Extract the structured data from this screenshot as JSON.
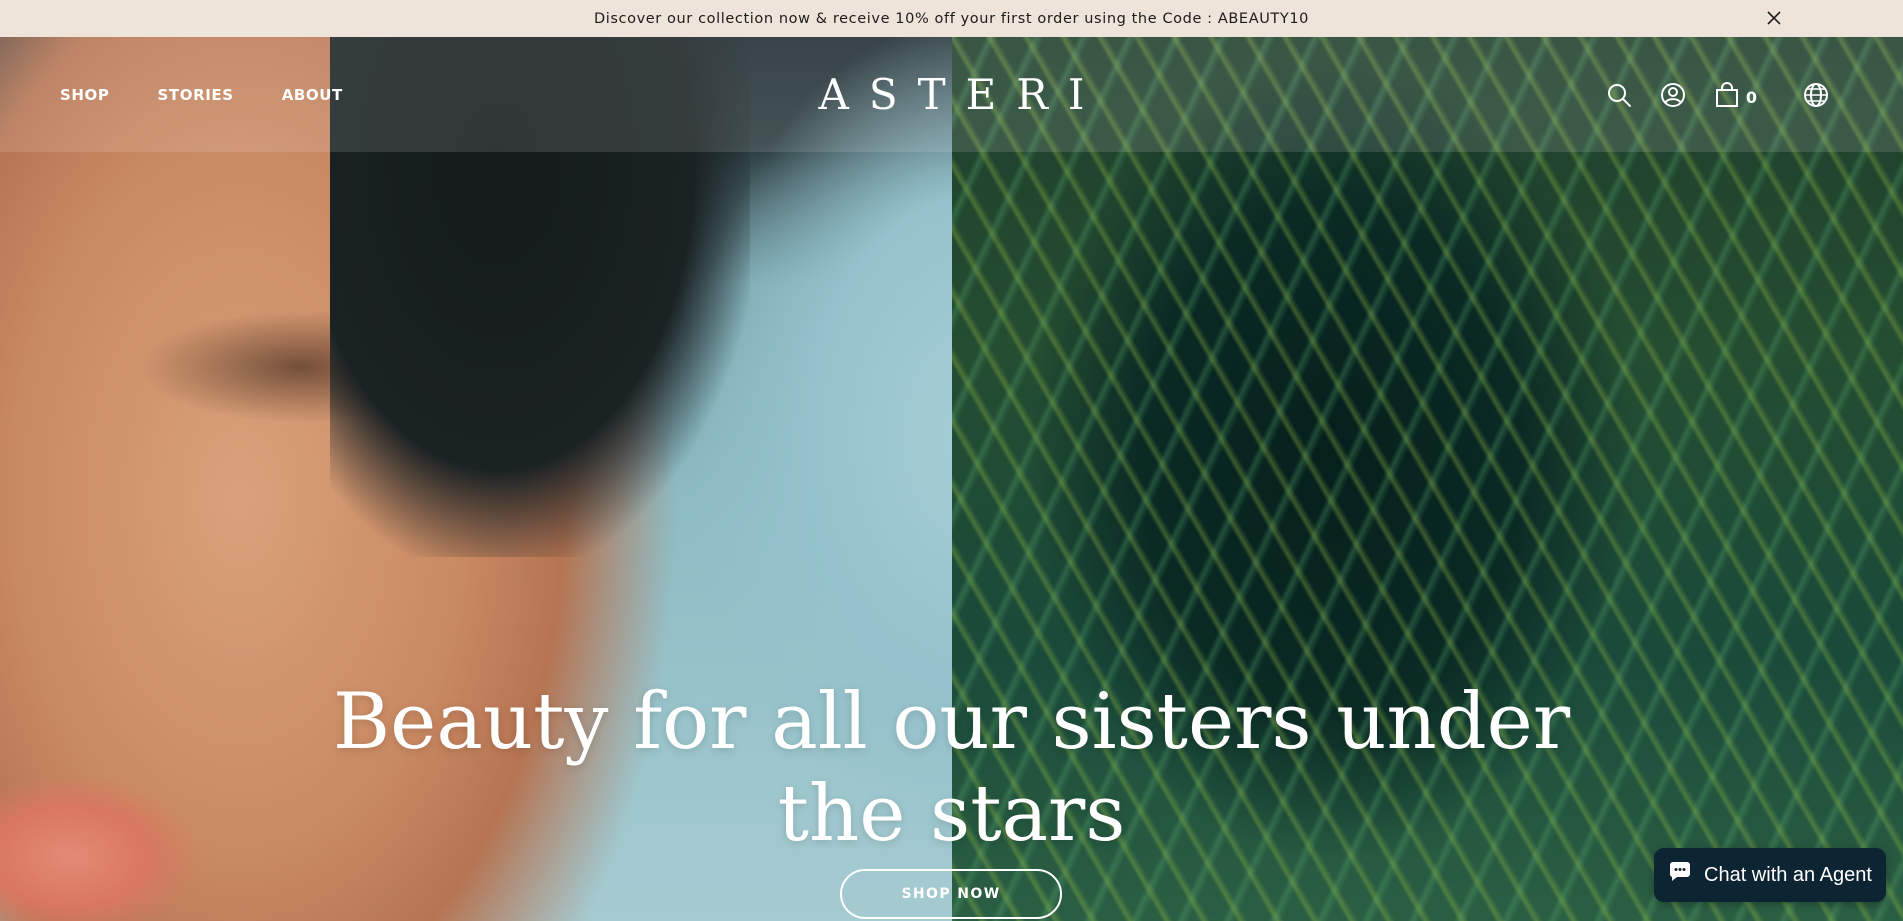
{
  "announcement": {
    "text": "Discover our collection now & receive 10% off your first order using the Code : ABEAUTY10",
    "close_icon": "close-icon"
  },
  "nav": {
    "links": [
      "SHOP",
      "STORIES",
      "ABOUT"
    ],
    "logo": "ASTERI",
    "icons": [
      "search-icon",
      "account-icon",
      "cart-icon",
      "globe-icon"
    ],
    "cart_count": "0"
  },
  "hero": {
    "headline_line1": "Beauty for all our sisters under",
    "headline_line2": "the stars",
    "cta": "SHOP NOW"
  },
  "chat": {
    "label": "Chat with an Agent",
    "icon": "chat-bubble-icon"
  },
  "colors": {
    "announcement_bg": "#efe4da",
    "chat_bg": "#0d2433"
  }
}
